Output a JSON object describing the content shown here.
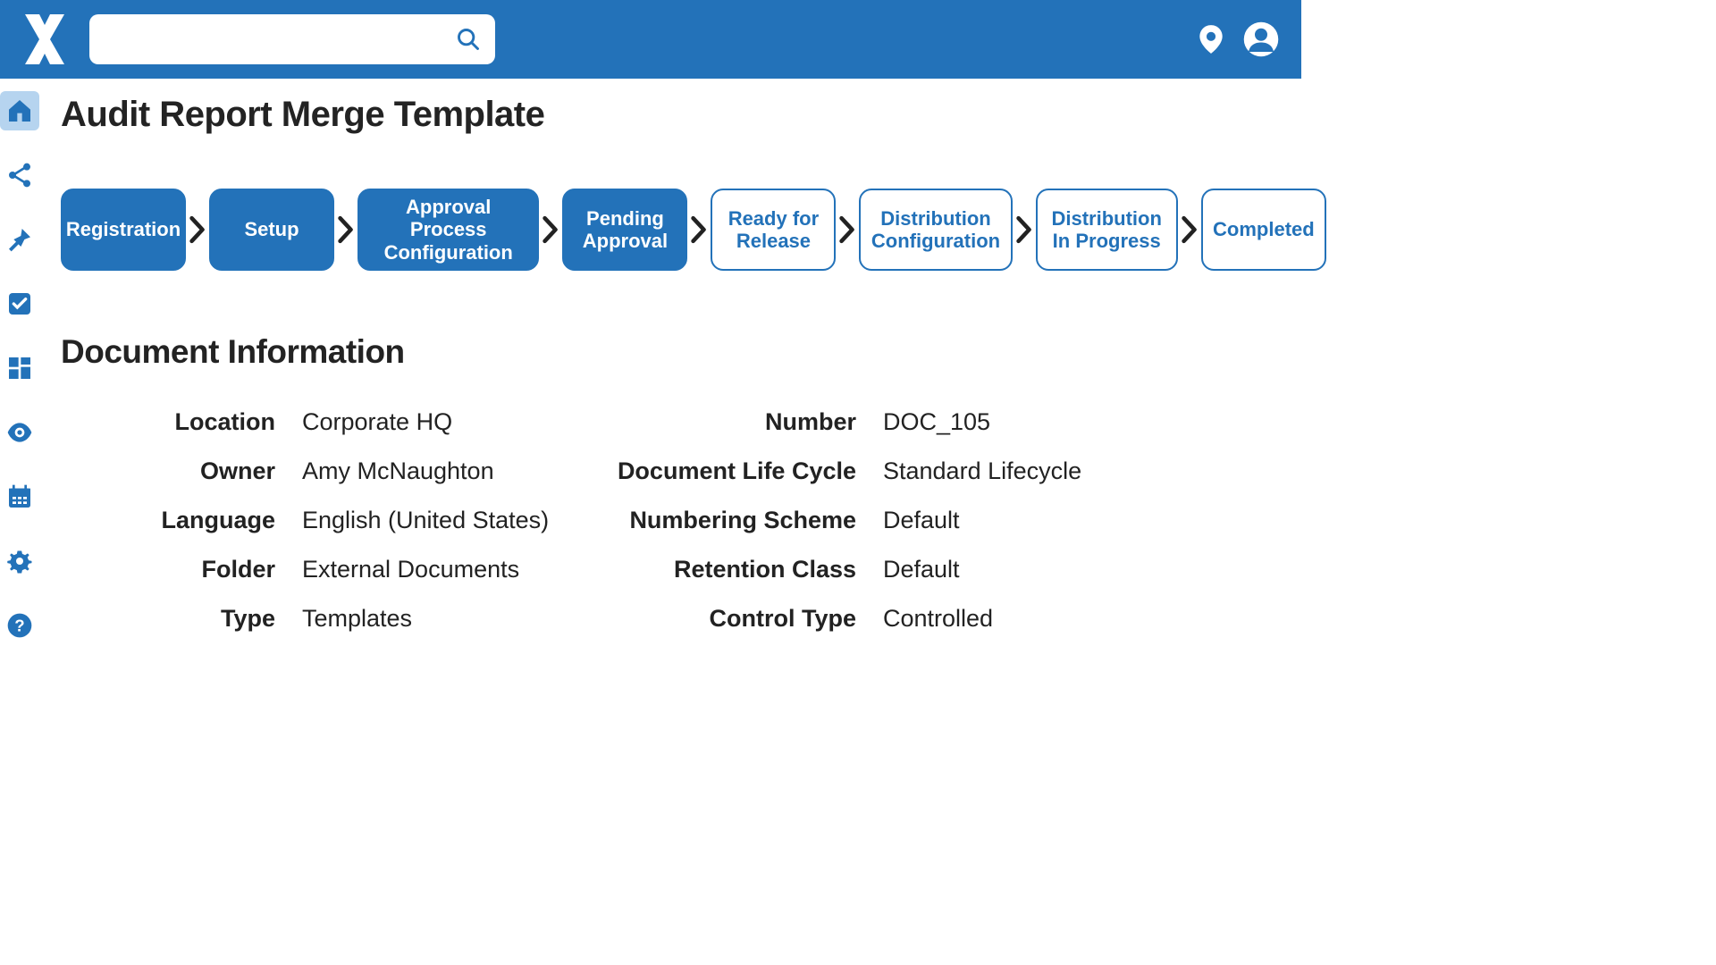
{
  "header": {
    "search_placeholder": ""
  },
  "sidebar": {
    "items": [
      {
        "name": "home",
        "active": true
      },
      {
        "name": "share",
        "active": false
      },
      {
        "name": "pin",
        "active": false
      },
      {
        "name": "checkbox",
        "active": false
      },
      {
        "name": "grid",
        "active": false
      },
      {
        "name": "eye",
        "active": false
      },
      {
        "name": "calendar",
        "active": false
      },
      {
        "name": "gear",
        "active": false
      },
      {
        "name": "help",
        "active": false
      }
    ]
  },
  "page": {
    "title": "Audit Report Merge Template",
    "section_title": "Document Information"
  },
  "workflow": [
    {
      "label": "Registration",
      "filled": true
    },
    {
      "label": "Setup",
      "filled": true
    },
    {
      "label": "Approval Process Configuration",
      "filled": true
    },
    {
      "label": "Pending Approval",
      "filled": true
    },
    {
      "label": "Ready for Release",
      "filled": false
    },
    {
      "label": "Distribution Configuration",
      "filled": false
    },
    {
      "label": "Distribution In Progress",
      "filled": false
    },
    {
      "label": "Completed",
      "filled": false
    }
  ],
  "info": {
    "left": [
      {
        "label": "Location",
        "value": "Corporate HQ"
      },
      {
        "label": "Owner",
        "value": "Amy McNaughton"
      },
      {
        "label": "Language",
        "value": "English (United States)"
      },
      {
        "label": "Folder",
        "value": "External Documents"
      },
      {
        "label": "Type",
        "value": "Templates"
      }
    ],
    "right": [
      {
        "label": "Number",
        "value": "DOC_105"
      },
      {
        "label": "Document Life Cycle",
        "value": "Standard Lifecycle"
      },
      {
        "label": "Numbering Scheme",
        "value": "Default"
      },
      {
        "label": "Retention Class",
        "value": "Default"
      },
      {
        "label": "Control Type",
        "value": "Controlled"
      }
    ]
  }
}
